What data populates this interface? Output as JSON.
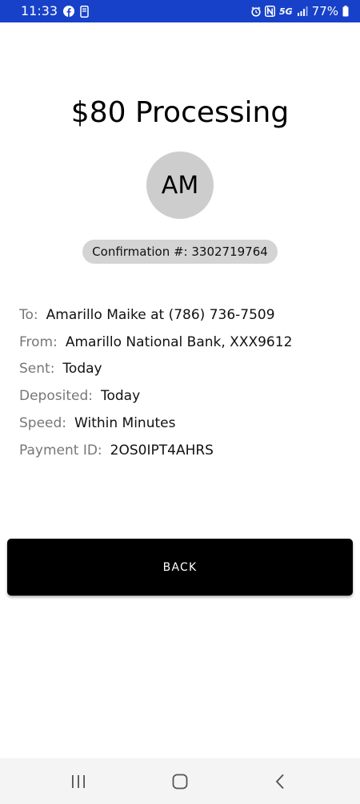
{
  "status_bar": {
    "time": "11:33",
    "battery": "77%",
    "network": "5G"
  },
  "payment": {
    "title": "$80 Processing",
    "avatar_initials": "AM",
    "confirmation": "Confirmation #: 3302719764"
  },
  "details": [
    {
      "label": "To:",
      "value": "Amarillo Maike at (786) 736-7509"
    },
    {
      "label": "From:",
      "value": "Amarillo National Bank, XXX9612"
    },
    {
      "label": "Sent:",
      "value": "Today"
    },
    {
      "label": "Deposited:",
      "value": "Today"
    },
    {
      "label": "Speed:",
      "value": "Within Minutes"
    },
    {
      "label": "Payment ID:",
      "value": "2OS0IPT4AHRS"
    }
  ],
  "actions": {
    "back_label": "BACK"
  },
  "colors": {
    "status_bar": "#1741c9",
    "button": "#000000",
    "avatar": "#cdcdcd",
    "pill": "#d4d4d4",
    "label": "#777777"
  }
}
